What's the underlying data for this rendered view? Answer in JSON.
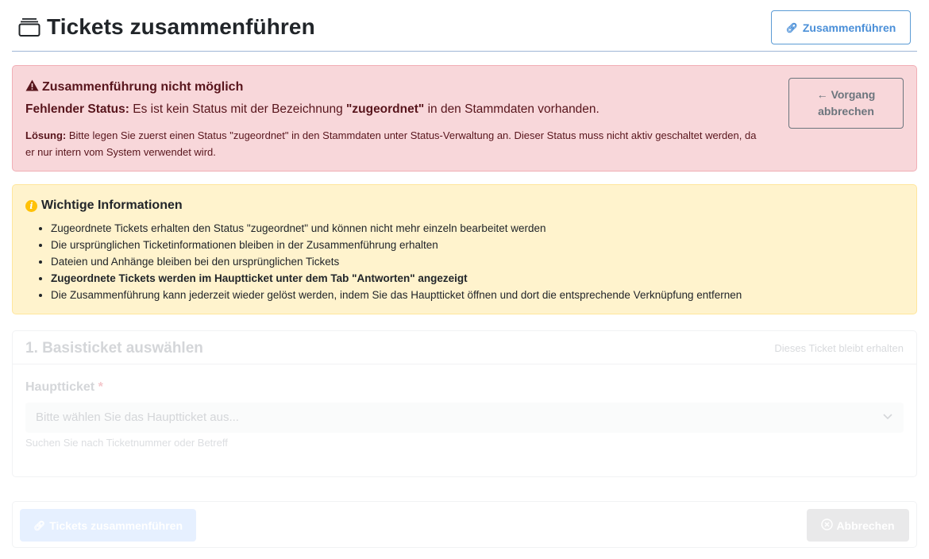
{
  "header": {
    "title": "Tickets zusammenführen",
    "title_icon": "stack-icon",
    "merge_button_label": "Zusammenführen",
    "merge_button_icon": "link-icon"
  },
  "error_alert": {
    "heading": "Zusammenführung nicht möglich",
    "heading_icon": "warning-triangle-icon",
    "status_label": "Fehlender Status:",
    "status_text_before": " Es ist kein Status mit der Bezeichnung ",
    "status_name": "\"zugeordnet\"",
    "status_text_after": " in den Stammdaten vorhanden.",
    "solution_label": "Lösung:",
    "solution_text": " Bitte legen Sie zuerst einen Status \"zugeordnet\" in den Stammdaten unter Status-Verwaltung an. Dieser Status muss nicht aktiv geschaltet werden, da er nur intern vom System verwendet wird.",
    "cancel_arrow": "←",
    "cancel_line1": "Vorgang",
    "cancel_line2": "abbrechen"
  },
  "info_box": {
    "heading": "Wichtige Informationen",
    "heading_icon": "info-icon",
    "items": [
      "Zugeordnete Tickets erhalten den Status \"zugeordnet\" und können nicht mehr einzeln bearbeitet werden",
      "Die ursprünglichen Ticketinformationen bleiben in der Zusammenführung erhalten",
      "Dateien und Anhänge bleiben bei den ursprünglichen Tickets",
      "Zugeordnete Tickets werden im Hauptticket unter dem Tab \"Antworten\" angezeigt",
      "Die Zusammenführung kann jederzeit wieder gelöst werden, indem Sie das Hauptticket öffnen und dort die entsprechende Verknüpfung entfernen"
    ]
  },
  "step1": {
    "title": "1. Basisticket auswählen",
    "hint": "Dieses Ticket bleibt erhalten",
    "field_label": "Hauptticket",
    "required_mark": "*",
    "select_placeholder": "Bitte wählen Sie das Hauptticket aus...",
    "help_text": "Suchen Sie nach Ticketnummer oder Betreff"
  },
  "footer": {
    "merge_label": "Tickets zusammenführen",
    "cancel_label": "Abbrechen"
  },
  "colors": {
    "danger_bg": "#f8d7da",
    "danger_text": "#58151c",
    "warning_bg": "#fff3cd",
    "accent_blue": "#4a8fd8",
    "info_yellow": "#ffc107"
  }
}
